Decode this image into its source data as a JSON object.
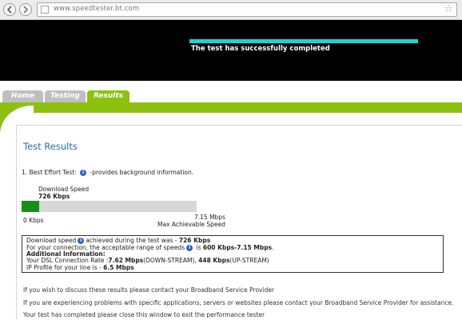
{
  "browser": {
    "url": "www.speedtester.bt.com"
  },
  "banner": {
    "status_text": "The test has successfully completed"
  },
  "tabs": [
    {
      "label": "Home"
    },
    {
      "label": "Testing"
    },
    {
      "label": "Results"
    }
  ],
  "results": {
    "heading": "Test Results",
    "test_line_prefix": "1. Best Effort Test:",
    "test_line_suffix": "-provides background information.",
    "download_label": "Download  Speed",
    "download_value": "726 Kbps",
    "progress_fraction": 0.1,
    "bar_min_label": "0 Kbps",
    "bar_max_value": "7.15 Mbps",
    "bar_max_label": "Max Achievable Speed",
    "info": {
      "line1_a": "Download speed",
      "line1_b": "achieved during the test was - ",
      "line1_value": "726 Kbps",
      "line2_a": "For your connection, the acceptable range of speeds",
      "line2_b": " is ",
      "line2_value": "600 Kbps-7.15 Mbps",
      "line2_end": ".",
      "line3": "Additional Information:",
      "line4_a": "Your DSL Connection Rate :",
      "line4_down": "7.62 Mbps",
      "line4_down_label": "(DOWN-STREAM), ",
      "line4_up": "448 Kbps",
      "line4_up_label": "(UP-STREAM)",
      "line5_a": "IP Profile for your line is - ",
      "line5_value": "6.5 Mbps"
    },
    "footer": [
      "If you wish to discuss these results please contact your Broadband Service Provider",
      "If you are experiencing problems with specific applications, servers or websites please contact your Broadband Service Provider for assistance.",
      "Your test has completed please close this window to exit the performance tester"
    ]
  },
  "colors": {
    "accent_green": "#8cc10f",
    "progress_cyan": "#19d3d9",
    "bar_fill": "#1a8d1a",
    "heading_blue": "#1f6fa8"
  }
}
